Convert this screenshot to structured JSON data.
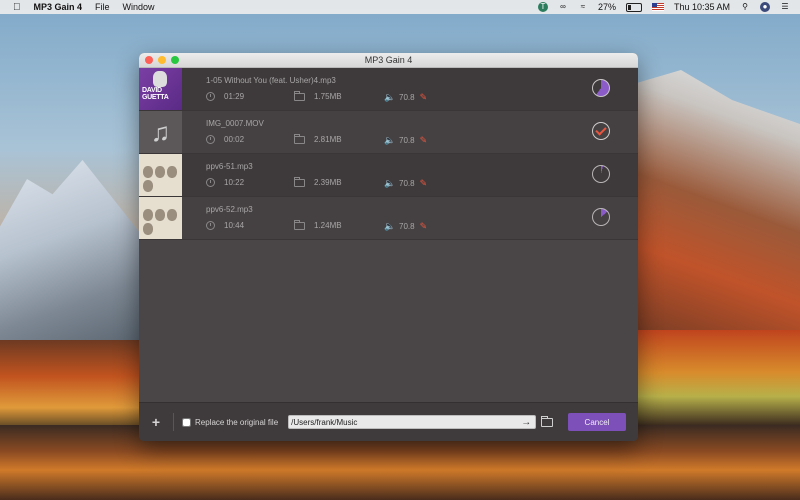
{
  "menubar": {
    "app_name": "MP3 Gain 4",
    "menus": [
      "File",
      "Window"
    ],
    "battery": "27%",
    "clock": "Thu 10:35 AM"
  },
  "window": {
    "title": "MP3 Gain 4"
  },
  "files": [
    {
      "name": "1-05 Without You (feat. Usher)4.mp3",
      "duration": "01:29",
      "size": "1.75MB",
      "volume": "70.8",
      "thumb_text": "DAVID GUETTA",
      "status": "in-progress",
      "progress": 0.6
    },
    {
      "name": "IMG_0007.MOV",
      "duration": "00:02",
      "size": "2.81MB",
      "volume": "70.8",
      "status": "done"
    },
    {
      "name": "ppv6-51.mp3",
      "duration": "10:22",
      "size": "2.39MB",
      "volume": "70.8",
      "status": "in-progress",
      "progress": 0.04
    },
    {
      "name": "ppv6-52.mp3",
      "duration": "10:44",
      "size": "1.24MB",
      "volume": "70.8",
      "status": "in-progress",
      "progress": 0.14
    }
  ],
  "footer": {
    "add_label": "+",
    "replace_label": "Replace the original file",
    "replace_checked": false,
    "output_path": "/Users/frank/Music",
    "cancel_label": "Cancel"
  },
  "colors": {
    "accent": "#7d4fb8",
    "edit_icon": "#e8563f"
  }
}
